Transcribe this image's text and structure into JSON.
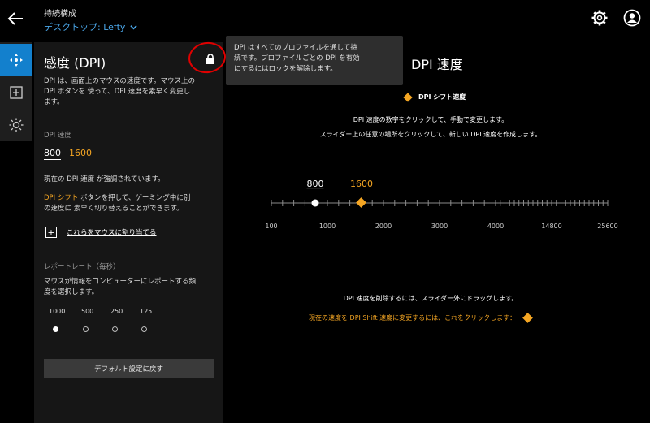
{
  "header": {
    "profile_label": "持続構成",
    "device_label": "デスクトップ: Lefty"
  },
  "panel": {
    "title": "感度 (DPI)",
    "description_line1": "DPI は、画面上のマウスの速度です。マウス上の",
    "description_line2": "DPI ボタンを 使って、DPI 速度を素早く変更し",
    "description_line3": "ます。",
    "dpi_speed_label": "DPI 速度",
    "dpi_values": [
      "800",
      "1600"
    ],
    "current_note": "現在の DPI 速度 が強調されています。",
    "shift_word": "DPI シフト",
    "shift_line1_rest": " ボタンを押して、ゲーミング中に別",
    "shift_line2": "の速度に 素早く切り替えることができます。",
    "assign_text": "これらをマウスに割り当てる",
    "report_rate_label": "レポートレート（毎秒）",
    "report_rate_desc1": "マウスが情報をコンピューターにレポートする頻",
    "report_rate_desc2": "度を選択します。",
    "report_rates": [
      "1000",
      "500",
      "250",
      "125"
    ],
    "selected_rate": "1000",
    "reset_label": "デフォルト設定に戻す"
  },
  "tooltip": {
    "line1": "DPI はすべてのプロファイルを通して持",
    "line2": "続です。プロファイルごとの DPI を有効",
    "line3": "にするにはロックを解除します。"
  },
  "main": {
    "title": "DPI 速度",
    "shift_label": "DPI シフト速度",
    "instruction1": "DPI 速度の数字をクリックして、手動で変更します。",
    "instruction2": "スライダー上の任意の場所をクリックして、新しい DPI 速度を作成します。",
    "slider_value_white": "800",
    "slider_value_yellow": "1600",
    "scale_labels": [
      "100",
      "1000",
      "2000",
      "3000",
      "4000",
      "14800",
      "25600"
    ],
    "delete_hint": "DPI 速度を削除するには、スライダー外にドラッグします。",
    "shift_hint": "現在の速度を DPI Shift 速度に変更するには、これをクリックします："
  },
  "icons": {
    "back": "back-arrow-icon",
    "settings": "gear-icon",
    "account": "user-icon",
    "rail": [
      "pointer-settings-icon",
      "add-assignment-icon",
      "lighting-icon"
    ],
    "lock": "lock-icon"
  },
  "colors": {
    "accent_blue": "#1380cd",
    "shift_yellow": "#f5a623",
    "annotation_red": "#e00000"
  }
}
